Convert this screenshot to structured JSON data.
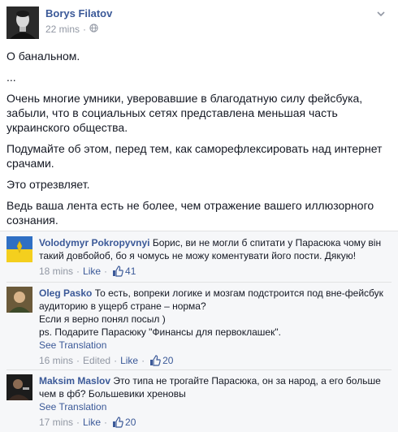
{
  "post": {
    "author": "Borys Filatov",
    "time": "22 mins",
    "dot": "·",
    "paragraphs": [
      "О банальном.",
      "...",
      "Очень многие умники, уверовавшие в благодатную силу фейсбука, забыли, что в социальных сетях представлена меньшая часть украинского общества.",
      "Подумайте об этом, перед тем, как саморефлексировать над интернет срачами.",
      "Это отрезвляет.",
      "Ведь ваша лента есть не более, чем отражение вашего иллюзорного сознания."
    ]
  },
  "comments": [
    {
      "author": "Volodymyr Pokropyvnyi",
      "text": "Борис, ви не могли б спитати у Парасюка чому він такий довбойоб, бо я чомусь не можу коментувати його пости. Дякую!",
      "see_translation": "",
      "time": "18 mins",
      "edited": "",
      "like": "Like",
      "likes": "41"
    },
    {
      "author": "Oleg Pasko",
      "text": "То есть, вопреки логике и мозгам подстроится под вне-фейсбук аудиторию в ущерб стране – норма?",
      "text2": "Если я верно понял посыл )",
      "text3": "ps. Подарите Парасюку \"Финансы для первоклашек\".",
      "see_translation": "See Translation",
      "time": "16 mins",
      "edited": "Edited",
      "like": "Like",
      "likes": "20"
    },
    {
      "author": "Maksim Maslov",
      "text": "Это типа не трогайте Парасюка, он за народ, а его больше чем в фб? Большевики хреновы",
      "see_translation": "See Translation",
      "time": "17 mins",
      "edited": "",
      "like": "Like",
      "likes": "20"
    }
  ],
  "icons": {
    "globe": "globe-icon",
    "chevron": "chevron-down-icon",
    "thumb": "thumbs-up-icon"
  },
  "colors": {
    "link": "#3b5998",
    "meta": "#9197a3",
    "comments_bg": "#f6f7f9"
  }
}
